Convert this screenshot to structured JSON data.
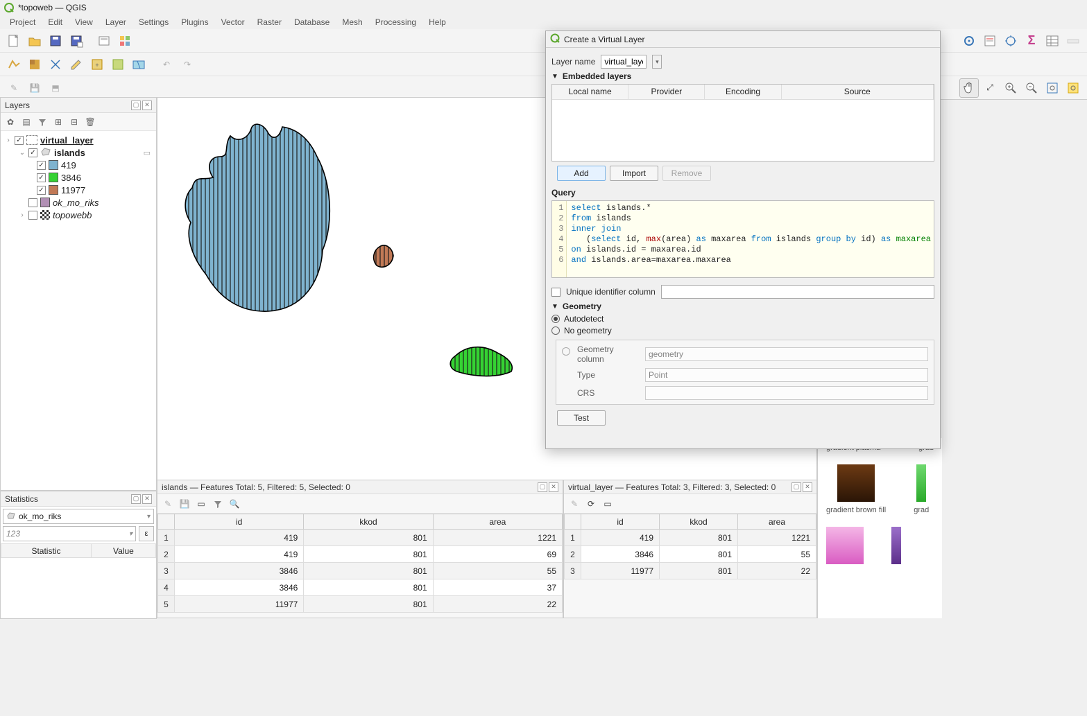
{
  "window": {
    "title": "*topoweb — QGIS"
  },
  "menu": [
    "Project",
    "Edit",
    "View",
    "Layer",
    "Settings",
    "Plugins",
    "Vector",
    "Raster",
    "Database",
    "Mesh",
    "Processing",
    "Help"
  ],
  "layers_panel": {
    "title": "Layers",
    "items": [
      {
        "visible": true,
        "name": "virtual_layer",
        "bold": true,
        "icon": "scratch"
      },
      {
        "visible": true,
        "name": "islands",
        "expanded": true,
        "icon": "polygons",
        "children": [
          {
            "visible": true,
            "color": "#7fb3cf",
            "label": "419"
          },
          {
            "visible": true,
            "color": "#35d233",
            "label": "3846"
          },
          {
            "visible": true,
            "color": "#c17956",
            "label": "11977"
          }
        ]
      },
      {
        "visible": false,
        "name": "ok_mo_riks",
        "italic": true,
        "color": "#b18fb4"
      },
      {
        "visible": false,
        "name": "topowebb",
        "italic": true,
        "icon": "wms"
      }
    ]
  },
  "stats_panel": {
    "title": "Statistics",
    "layer_selected": "ok_mo_riks",
    "expr_placeholder": "123",
    "headers": [
      "Statistic",
      "Value"
    ],
    "epsilon_btn": "ε"
  },
  "attr_left": {
    "title": "islands — Features Total: 5, Filtered: 5, Selected: 0",
    "cols": [
      "id",
      "kkod",
      "area"
    ],
    "rows": [
      [
        "1",
        "419",
        "801",
        "1221"
      ],
      [
        "2",
        "419",
        "801",
        "69"
      ],
      [
        "3",
        "3846",
        "801",
        "55"
      ],
      [
        "4",
        "3846",
        "801",
        "37"
      ],
      [
        "5",
        "11977",
        "801",
        "22"
      ]
    ]
  },
  "attr_right": {
    "title": "virtual_layer — Features Total: 3, Filtered: 3, Selected: 0",
    "cols": [
      "id",
      "kkod",
      "area"
    ],
    "rows": [
      [
        "1",
        "419",
        "801",
        "1221"
      ],
      [
        "2",
        "3846",
        "801",
        "55"
      ],
      [
        "3",
        "11977",
        "801",
        "22"
      ]
    ]
  },
  "dialog": {
    "title": "Create a Virtual Layer",
    "layer_name_label": "Layer name",
    "layer_name_value": "virtual_layer",
    "embedded_header": "Embedded layers",
    "embedded_cols": [
      "Local name",
      "Provider",
      "Encoding",
      "Source"
    ],
    "btn_add": "Add",
    "btn_import": "Import",
    "btn_remove": "Remove",
    "query_label": "Query",
    "query_lines": [
      "select islands.*",
      "from islands",
      "inner join",
      "   (select id, max(area) as maxarea from islands group by id) as maxarea",
      "on islands.id = maxarea.id",
      "and islands.area=maxarea.maxarea"
    ],
    "uid_label": "Unique identifier column",
    "geometry_header": "Geometry",
    "radio_autodetect": "Autodetect",
    "radio_nogeom": "No geometry",
    "geom_col_label": "Geometry column",
    "geom_col_value": "geometry",
    "type_label": "Type",
    "type_value": "Point",
    "crs_label": "CRS",
    "btn_test": "Test"
  },
  "symbols": {
    "row1_labels": [
      "gradient   plasma",
      "grad"
    ],
    "brown_label": "gradient brown fill",
    "grad_label": "grad"
  }
}
